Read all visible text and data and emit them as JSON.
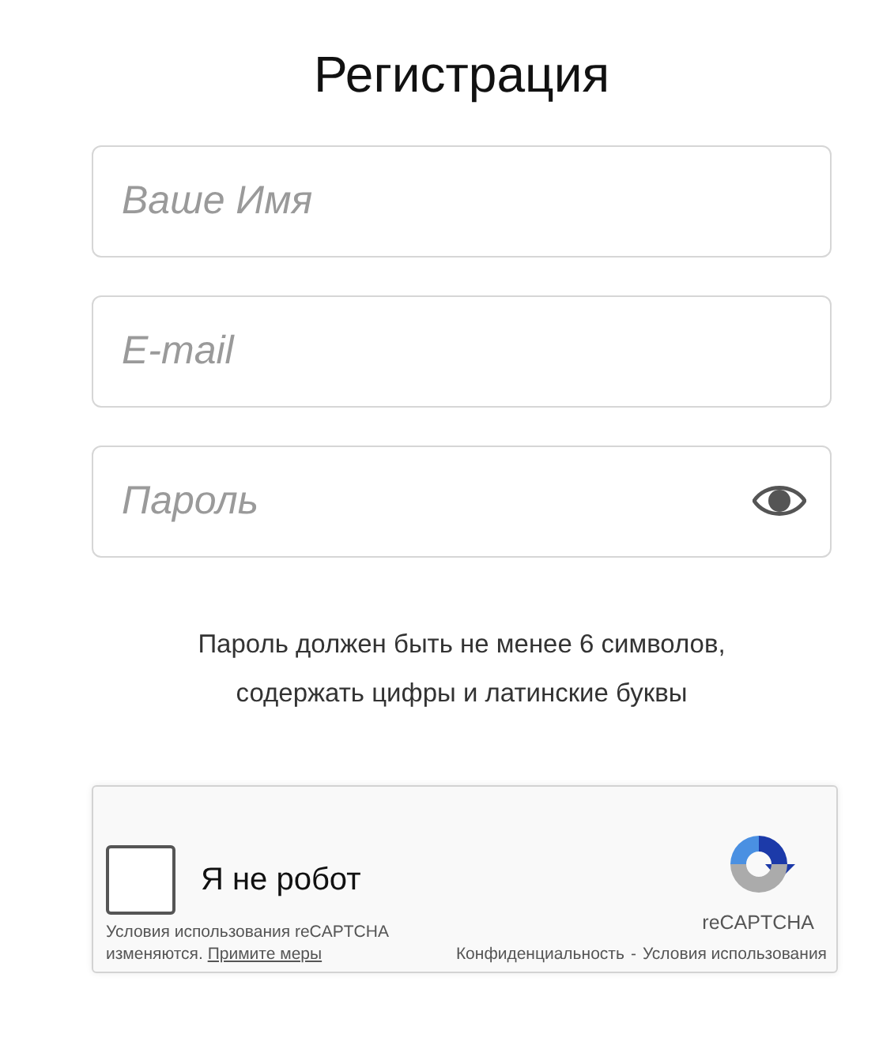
{
  "title": "Регистрация",
  "fields": [
    {
      "placeholder": "Ваше Имя",
      "kind": "text"
    },
    {
      "placeholder": "E-mail",
      "kind": "text"
    },
    {
      "placeholder": "Пароль",
      "kind": "password"
    }
  ],
  "hint": [
    "Пароль должен быть не менее 6 символов,",
    "содержать цифры и латинские буквы"
  ],
  "captcha": {
    "label": "Я не робот",
    "checked": false,
    "brand": "reCAPTCHA",
    "notice": "Условия использования reCAPTCHA изменяются.",
    "notice_link": "Примите меры",
    "links": [
      "Конфиденциальность",
      "-",
      "Условия использования"
    ]
  }
}
